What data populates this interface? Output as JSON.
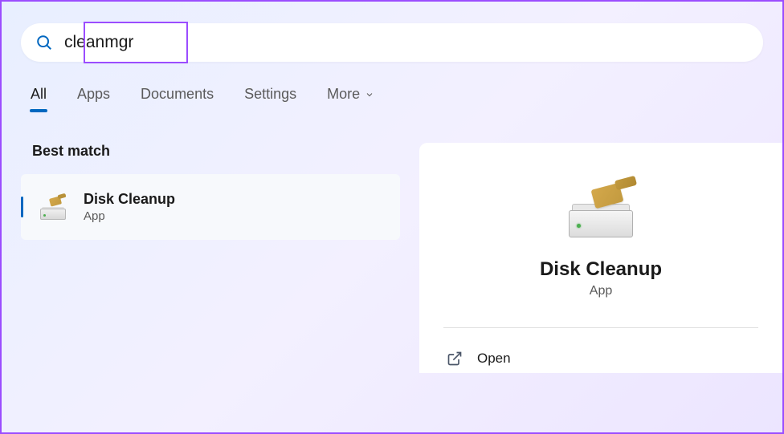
{
  "search": {
    "query": "cleanmgr",
    "placeholder": ""
  },
  "filters": {
    "all": "All",
    "apps": "Apps",
    "documents": "Documents",
    "settings": "Settings",
    "more": "More"
  },
  "results": {
    "section_label": "Best match",
    "items": [
      {
        "title": "Disk Cleanup",
        "subtitle": "App"
      }
    ]
  },
  "detail": {
    "title": "Disk Cleanup",
    "subtitle": "App",
    "actions": {
      "open": "Open"
    }
  }
}
